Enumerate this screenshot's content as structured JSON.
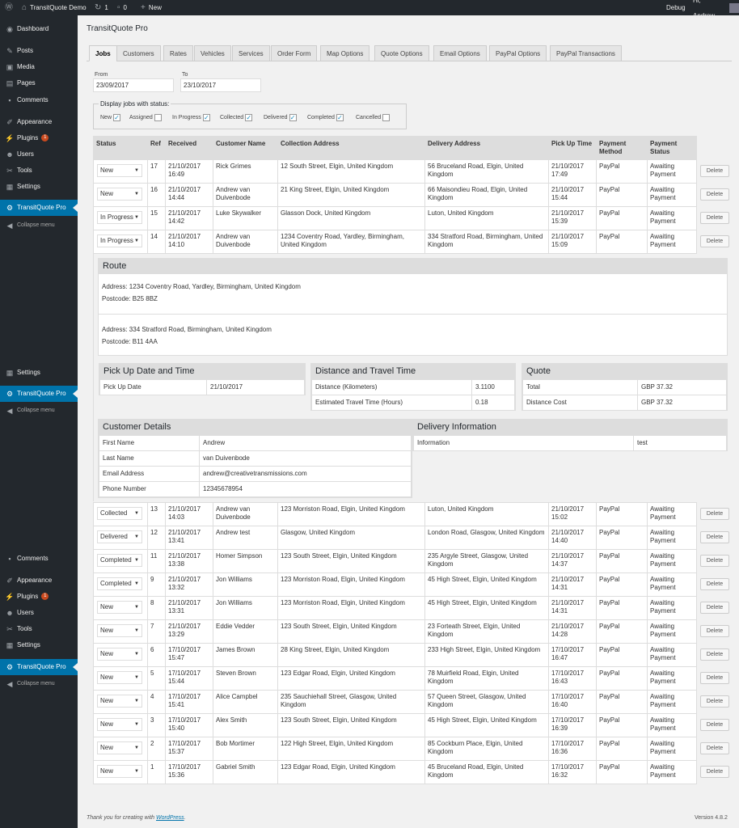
{
  "adminbar": {
    "site": "TransitQuote Demo",
    "updates": "1",
    "comments": "0",
    "new": "New",
    "debug": "Debug",
    "greeting": "Hi, Andrew"
  },
  "menu": {
    "dashboard": "Dashboard",
    "posts": "Posts",
    "media": "Media",
    "pages": "Pages",
    "comments": "Comments",
    "appearance": "Appearance",
    "plugins": "Plugins",
    "plugins_badge": "1",
    "users": "Users",
    "tools": "Tools",
    "settings": "Settings",
    "transitquote": "TransitQuote Pro",
    "collapse": "Collapse menu"
  },
  "page_title": "TransitQuote Pro",
  "tabs": [
    "Jobs",
    "Customers",
    "Rates",
    "Vehicles",
    "Services",
    "Order Form",
    "Map Options",
    "Quote Options",
    "Email Options",
    "PayPal Options",
    "PayPal Transactions"
  ],
  "filter": {
    "from_label": "From",
    "from_value": "23/09/2017",
    "to_label": "To",
    "to_value": "23/10/2017",
    "status_legend": "Display jobs with status:",
    "statuses": [
      {
        "label": "New",
        "checked": true
      },
      {
        "label": "Assigned",
        "checked": false
      },
      {
        "label": "In Progress",
        "checked": true
      },
      {
        "label": "Collected",
        "checked": true
      },
      {
        "label": "Delivered",
        "checked": true
      },
      {
        "label": "Completed",
        "checked": true
      },
      {
        "label": "Cancelled",
        "checked": false
      }
    ]
  },
  "table": {
    "headers": [
      "Status",
      "Ref",
      "Received",
      "Customer Name",
      "Collection Address",
      "Delivery Address",
      "Pick Up Time",
      "Payment Method",
      "Payment Status"
    ],
    "delete_label": "Delete",
    "rows_top": [
      {
        "status": "New",
        "ref": "17",
        "received": "21/10/2017 16:49",
        "customer": "Rick Grimes",
        "collection": "12 South Street, Elgin, United Kingdom",
        "delivery": "56 Bruceland Road, Elgin, United Kingdom",
        "pickup": "21/10/2017 17:49",
        "method": "PayPal",
        "pstatus": "Awaiting Payment"
      },
      {
        "status": "New",
        "ref": "16",
        "received": "21/10/2017 14:44",
        "customer": "Andrew van Duivenbode",
        "collection": "21 King Street, Elgin, United Kingdom",
        "delivery": "66 Maisondieu Road, Elgin, United Kingdom",
        "pickup": "21/10/2017 15:44",
        "method": "PayPal",
        "pstatus": "Awaiting Payment"
      },
      {
        "status": "In Progress",
        "ref": "15",
        "received": "21/10/2017 14:42",
        "customer": "Luke Skywalker",
        "collection": "Glasson Dock, United Kingdom",
        "delivery": "Luton, United Kingdom",
        "pickup": "21/10/2017 15:39",
        "method": "PayPal",
        "pstatus": "Awaiting Payment"
      },
      {
        "status": "In Progress",
        "ref": "14",
        "received": "21/10/2017 14:10",
        "customer": "Andrew van Duivenbode",
        "collection": "1234 Coventry Road, Yardley, Birmingham, United Kingdom",
        "delivery": "334 Stratford Road, Birmingham, United Kingdom",
        "pickup": "21/10/2017 15:09",
        "method": "PayPal",
        "pstatus": "Awaiting Payment"
      }
    ],
    "rows_bottom": [
      {
        "status": "Collected",
        "ref": "13",
        "received": "21/10/2017 14:03",
        "customer": "Andrew van Duivenbode",
        "collection": "123 Morriston Road, Elgin, United Kingdom",
        "delivery": "Luton, United Kingdom",
        "pickup": "21/10/2017 15:02",
        "method": "PayPal",
        "pstatus": "Awaiting Payment"
      },
      {
        "status": "Delivered",
        "ref": "12",
        "received": "21/10/2017 13:41",
        "customer": "Andrew test",
        "collection": "Glasgow, United Kingdom",
        "delivery": "London Road, Glasgow, United Kingdom",
        "pickup": "21/10/2017 14:40",
        "method": "PayPal",
        "pstatus": "Awaiting Payment"
      },
      {
        "status": "Completed",
        "ref": "11",
        "received": "21/10/2017 13:38",
        "customer": "Homer Simpson",
        "collection": "123 South Street, Elgin, United Kingdom",
        "delivery": "235 Argyle Street, Glasgow, United Kingdom",
        "pickup": "21/10/2017 14:37",
        "method": "PayPal",
        "pstatus": "Awaiting Payment"
      },
      {
        "status": "Completed",
        "ref": "9",
        "received": "21/10/2017 13:32",
        "customer": "Jon Williams",
        "collection": "123 Morriston Road, Elgin, United Kingdom",
        "delivery": "45 High Street, Elgin, United Kingdom",
        "pickup": "21/10/2017 14:31",
        "method": "PayPal",
        "pstatus": "Awaiting Payment"
      },
      {
        "status": "New",
        "ref": "8",
        "received": "21/10/2017 13:31",
        "customer": "Jon Williams",
        "collection": "123 Morriston Road, Elgin, United Kingdom",
        "delivery": "45 High Street, Elgin, United Kingdom",
        "pickup": "21/10/2017 14:31",
        "method": "PayPal",
        "pstatus": "Awaiting Payment"
      },
      {
        "status": "New",
        "ref": "7",
        "received": "21/10/2017 13:29",
        "customer": "Eddie Vedder",
        "collection": "123 South Street, Elgin, United Kingdom",
        "delivery": "23 Forteath Street, Elgin, United Kingdom",
        "pickup": "21/10/2017 14:28",
        "method": "PayPal",
        "pstatus": "Awaiting Payment"
      },
      {
        "status": "New",
        "ref": "6",
        "received": "17/10/2017 15:47",
        "customer": "James Brown",
        "collection": "28 King Street, Elgin, United Kingdom",
        "delivery": "233 High Street, Elgin, United Kingdom",
        "pickup": "17/10/2017 16:47",
        "method": "PayPal",
        "pstatus": "Awaiting Payment"
      },
      {
        "status": "New",
        "ref": "5",
        "received": "17/10/2017 15:44",
        "customer": "Steven Brown",
        "collection": "123 Edgar Road, Elgin, United Kingdom",
        "delivery": "78 Muirfield Road, Elgin, United Kingdom",
        "pickup": "17/10/2017 16:43",
        "method": "PayPal",
        "pstatus": "Awaiting Payment"
      },
      {
        "status": "New",
        "ref": "4",
        "received": "17/10/2017 15:41",
        "customer": "Alice Campbel",
        "collection": "235 Sauchiehall Street, Glasgow, United Kingdom",
        "delivery": "57 Queen Street, Glasgow, United Kingdom",
        "pickup": "17/10/2017 16:40",
        "method": "PayPal",
        "pstatus": "Awaiting Payment"
      },
      {
        "status": "New",
        "ref": "3",
        "received": "17/10/2017 15:40",
        "customer": "Alex Smith",
        "collection": "123 South Street, Elgin, United Kingdom",
        "delivery": "45 High Street, Elgin, United Kingdom",
        "pickup": "17/10/2017 16:39",
        "method": "PayPal",
        "pstatus": "Awaiting Payment"
      },
      {
        "status": "New",
        "ref": "2",
        "received": "17/10/2017 15:37",
        "customer": "Bob Mortimer",
        "collection": "122 High Street, Elgin, United Kingdom",
        "delivery": "85 Cockburn Place, Elgin, United Kingdom",
        "pickup": "17/10/2017 16:36",
        "method": "PayPal",
        "pstatus": "Awaiting Payment"
      },
      {
        "status": "New",
        "ref": "1",
        "received": "17/10/2017 15:36",
        "customer": "Gabriel Smith",
        "collection": "123 Edgar Road, Elgin, United Kingdom",
        "delivery": "45 Bruceland Road, Elgin, United Kingdom",
        "pickup": "17/10/2017 16:32",
        "method": "PayPal",
        "pstatus": "Awaiting Payment"
      }
    ]
  },
  "detail": {
    "route_title": "Route",
    "from_address": "Address: 1234 Coventry Road, Yardley, Birmingham, United Kingdom",
    "from_postcode": "Postcode: B25 8BZ",
    "to_address": "Address: 334 Stratford Road, Birmingham, United Kingdom",
    "to_postcode": "Postcode: B11 4AA",
    "pickup_title": "Pick Up Date and Time",
    "pickup_label": "Pick Up Date",
    "pickup_value": "21/10/2017",
    "distance_title": "Distance and Travel Time",
    "distance_label": "Distance (Kilometers)",
    "distance_value": "3.1100",
    "time_label": "Estimated Travel Time (Hours)",
    "time_value": "0.18",
    "quote_title": "Quote",
    "total_label": "Total",
    "total_value": "GBP 37.32",
    "dcost_label": "Distance Cost",
    "dcost_value": "GBP 37.32",
    "customer_title": "Customer Details",
    "customer_rows": [
      [
        "First Name",
        "Andrew"
      ],
      [
        "Last Name",
        "van Duivenbode"
      ],
      [
        "Email Address",
        "andrew@creativetransmissions.com"
      ],
      [
        "Phone Number",
        "12345678954"
      ]
    ],
    "delivery_title": "Delivery Information",
    "info_label": "Information",
    "info_value": "test"
  },
  "footer": {
    "thanks": "Thank you for creating with ",
    "wp": "WordPress",
    "dot": ".",
    "version": "Version 4.8.2"
  }
}
